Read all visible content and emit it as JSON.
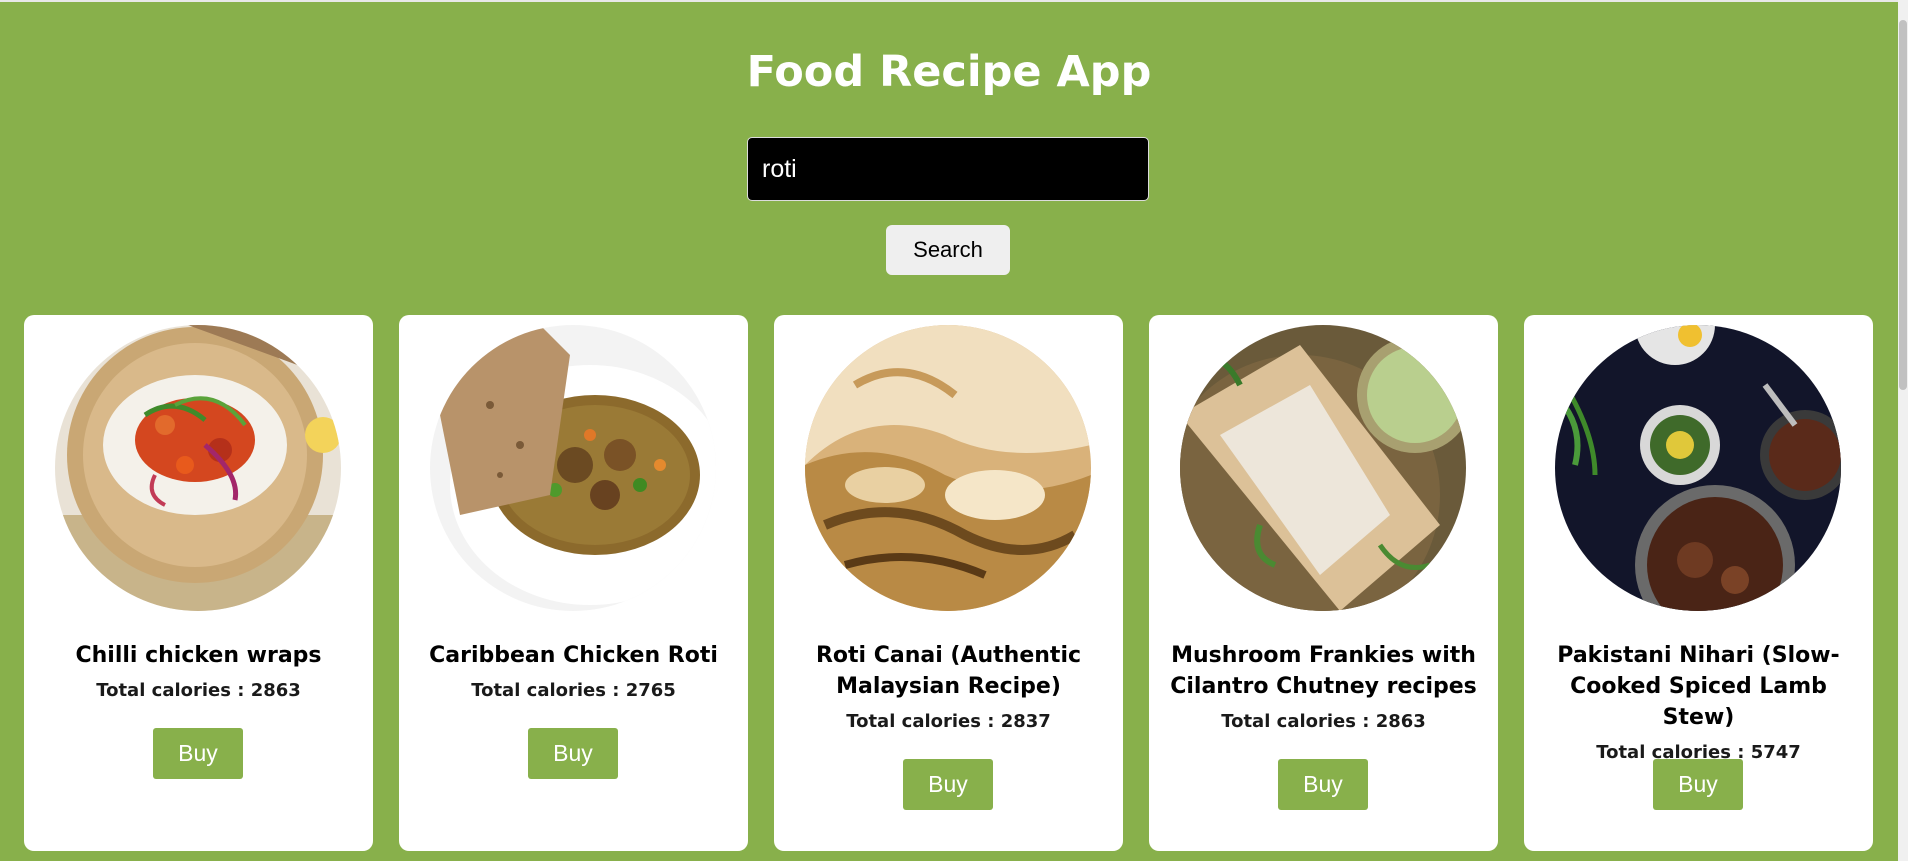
{
  "app": {
    "title": "Food Recipe App"
  },
  "search": {
    "value": "roti",
    "button_label": "Search"
  },
  "colors": {
    "background": "#88b04b",
    "card": "#ffffff",
    "buy_button": "#88b04b"
  },
  "recipes": [
    {
      "name": "Chilli chicken wraps",
      "calories_text": "Total calories : 2863",
      "buy_label": "Buy",
      "image_icon": "chilli-chicken-wrap-photo"
    },
    {
      "name": "Caribbean Chicken Roti",
      "calories_text": "Total calories : 2765",
      "buy_label": "Buy",
      "image_icon": "chicken-curry-roti-photo"
    },
    {
      "name": "Roti Canai (Authentic Malaysian Recipe)",
      "calories_text": "Total calories : 2837",
      "buy_label": "Buy",
      "image_icon": "flaky-flatbread-photo"
    },
    {
      "name": "Mushroom Frankies with Cilantro Chutney recipes",
      "calories_text": "Total calories : 2863",
      "buy_label": "Buy",
      "image_icon": "wrapped-frankie-photo"
    },
    {
      "name": "Pakistani Nihari (Slow-Cooked Spiced Lamb Stew)",
      "calories_text": "Total calories : 5747",
      "buy_label": "Buy",
      "image_icon": "lamb-stew-table-photo"
    }
  ]
}
